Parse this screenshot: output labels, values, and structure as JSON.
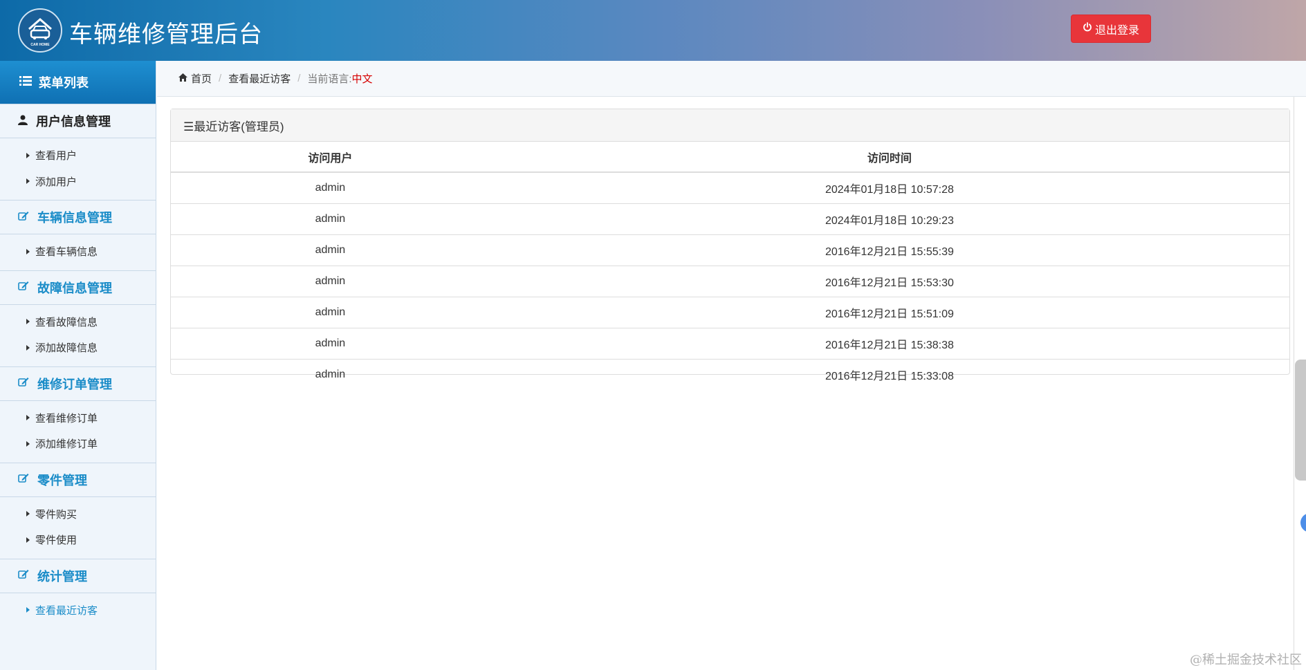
{
  "header": {
    "title": "车辆维修管理后台",
    "logo_text": "CAR HOME",
    "logout_label": "退出登录"
  },
  "sidebar": {
    "title": "菜单列表",
    "groups": [
      {
        "label": "用户信息管理",
        "icon": "user-icon",
        "items": [
          {
            "label": "查看用户"
          },
          {
            "label": "添加用户"
          }
        ]
      },
      {
        "label": "车辆信息管理",
        "icon": "edit-icon",
        "items": [
          {
            "label": "查看车辆信息"
          }
        ]
      },
      {
        "label": "故障信息管理",
        "icon": "edit-icon",
        "items": [
          {
            "label": "查看故障信息"
          },
          {
            "label": "添加故障信息"
          }
        ]
      },
      {
        "label": "维修订单管理",
        "icon": "edit-icon",
        "items": [
          {
            "label": "查看维修订单"
          },
          {
            "label": "添加维修订单"
          }
        ]
      },
      {
        "label": "零件管理",
        "icon": "edit-icon",
        "items": [
          {
            "label": "零件购买"
          },
          {
            "label": "零件使用"
          }
        ]
      },
      {
        "label": "统计管理",
        "icon": "edit-icon",
        "items": [
          {
            "label": "查看最近访客"
          }
        ]
      }
    ]
  },
  "breadcrumb": {
    "home": "首页",
    "current": "查看最近访客",
    "language_label": "当前语言:",
    "language_value": "中文"
  },
  "panel": {
    "title": "☰最近访客(管理员)",
    "columns": [
      "访问用户",
      "访问时间"
    ],
    "rows": [
      [
        "admin",
        "2024年01月18日 10:57:28"
      ],
      [
        "admin",
        "2024年01月18日 10:29:23"
      ],
      [
        "admin",
        "2016年12月21日 15:55:39"
      ],
      [
        "admin",
        "2016年12月21日 15:53:30"
      ],
      [
        "admin",
        "2016年12月21日 15:51:09"
      ],
      [
        "admin",
        "2016年12月21日 15:38:38"
      ],
      [
        "admin",
        "2016年12月21日 15:33:08"
      ]
    ]
  },
  "watermark": "@稀土掘金技术社区",
  "colors": {
    "accent": "#1a8cc8",
    "logout": "#e8353a",
    "language_value": "#d60000"
  }
}
